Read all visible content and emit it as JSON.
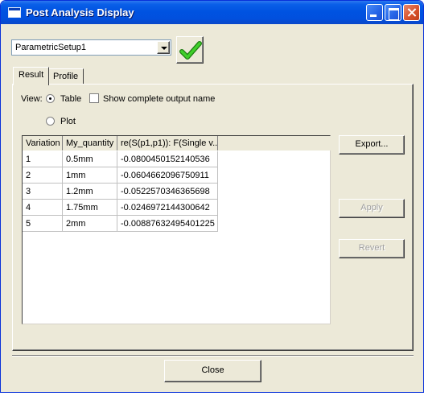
{
  "window": {
    "title": "Post Analysis Display"
  },
  "setup": {
    "selected": "ParametricSetup1"
  },
  "tabs": [
    {
      "label": "Result"
    },
    {
      "label": "Profile"
    }
  ],
  "view": {
    "label": "View:",
    "table_label": "Table",
    "show_complete_label": "Show complete output name",
    "plot_label": "Plot",
    "table_selected": true,
    "show_complete_checked": false
  },
  "table": {
    "headers": [
      "Variation",
      "My_quantity",
      "re(S(p1,p1)): F(Single v..."
    ],
    "rows": [
      [
        "1",
        "0.5mm",
        "-0.0800450152140536"
      ],
      [
        "2",
        "1mm",
        "-0.0604662096750911"
      ],
      [
        "3",
        "1.2mm",
        "-0.0522570346365698"
      ],
      [
        "4",
        "1.75mm",
        "-0.0246972144300642"
      ],
      [
        "5",
        "2mm",
        "-0.00887632495401225"
      ]
    ]
  },
  "buttons": {
    "export": "Export...",
    "apply": "Apply",
    "revert": "Revert",
    "close": "Close"
  },
  "colors": {
    "check": "#2fae1e"
  }
}
